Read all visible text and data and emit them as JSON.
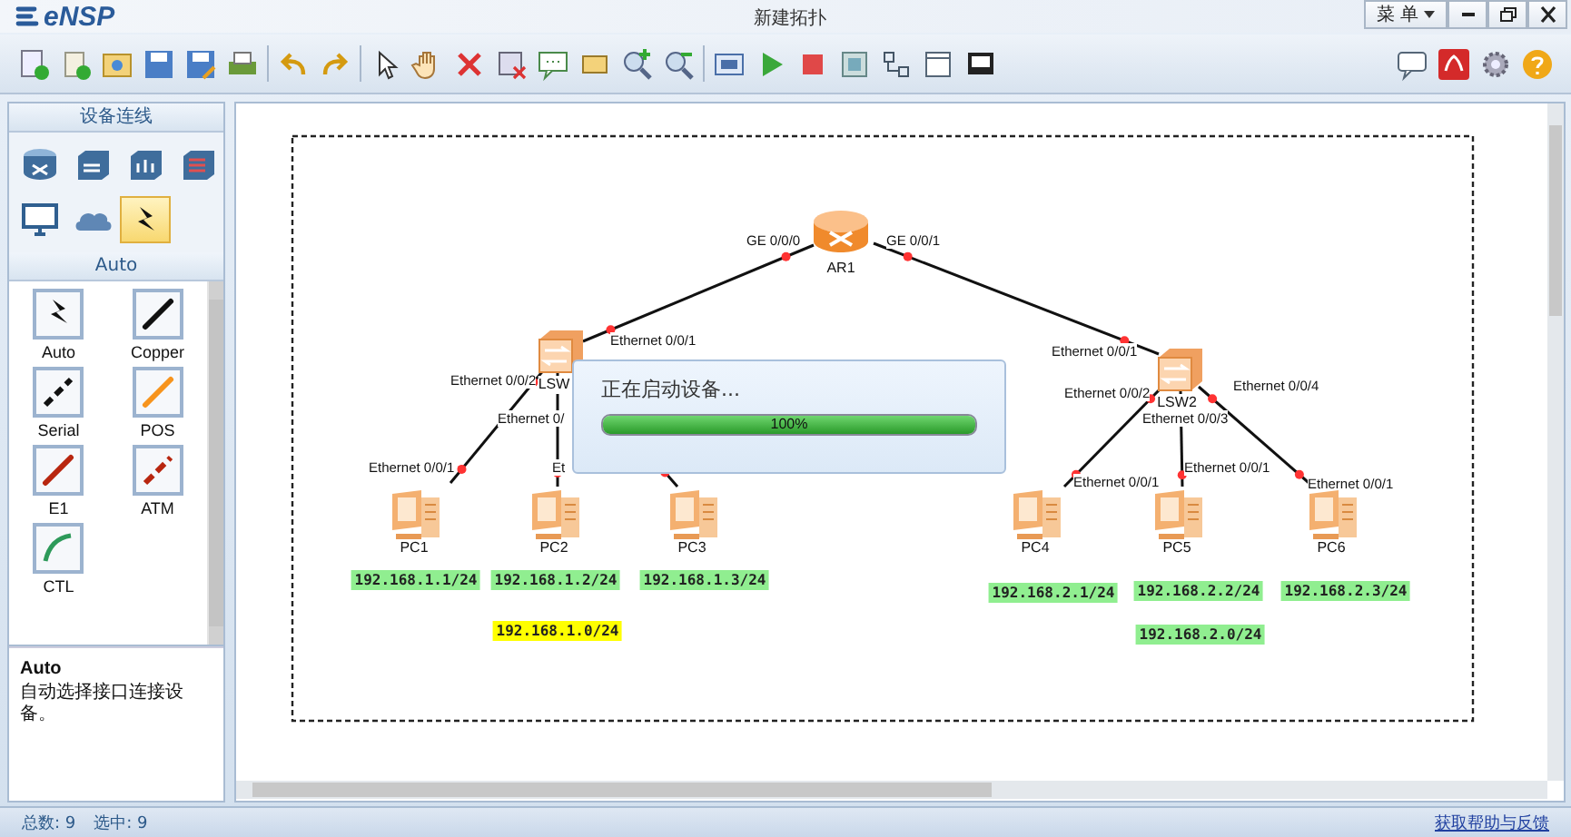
{
  "window": {
    "app_name": "eNSP",
    "title": "新建拓扑",
    "menu_label": "菜 单"
  },
  "sidebar": {
    "title": "设备连线",
    "categories": [
      {
        "kind": "router",
        "selected": false
      },
      {
        "kind": "switch",
        "selected": false
      },
      {
        "kind": "wireless",
        "selected": false
      },
      {
        "kind": "firewall",
        "selected": false
      },
      {
        "kind": "pc",
        "selected": false
      },
      {
        "kind": "cloud",
        "selected": false
      },
      {
        "kind": "cable",
        "selected": true
      }
    ],
    "group_title": "Auto",
    "cable_types": [
      {
        "kind": "auto",
        "label": "Auto"
      },
      {
        "kind": "copper",
        "label": "Copper"
      },
      {
        "kind": "serial",
        "label": "Serial"
      },
      {
        "kind": "pos",
        "label": "POS"
      },
      {
        "kind": "e1",
        "label": "E1"
      },
      {
        "kind": "atm",
        "label": "ATM"
      },
      {
        "kind": "ctl",
        "label": "CTL"
      }
    ],
    "description": {
      "title": "Auto",
      "text": "自动选择接口连接设备。"
    }
  },
  "topology": {
    "nodes": [
      {
        "kind": "router",
        "name": "AR1"
      },
      {
        "kind": "switch",
        "name": "LSW"
      },
      {
        "kind": "switch",
        "name": "LSW2"
      },
      {
        "kind": "pc",
        "name": "PC1"
      },
      {
        "kind": "pc",
        "name": "PC2"
      },
      {
        "kind": "pc",
        "name": "PC3"
      },
      {
        "kind": "pc",
        "name": "PC4"
      },
      {
        "kind": "pc",
        "name": "PC5"
      },
      {
        "kind": "pc",
        "name": "PC6"
      }
    ],
    "links": [
      {
        "kind": "copper",
        "ports": [
          "GE 0/0/0",
          "Ethernet 0/0/1"
        ]
      },
      {
        "kind": "copper",
        "ports": [
          "GE 0/0/1",
          "Ethernet 0/0/1"
        ]
      },
      {
        "kind": "copper",
        "ports": [
          "Ethernet 0/0/2",
          "Ethernet 0/0/1"
        ]
      },
      {
        "kind": "copper",
        "ports": [
          "Ethernet 0/",
          "Et"
        ]
      },
      {
        "kind": "copper"
      },
      {
        "kind": "copper",
        "ports": [
          "Ethernet 0/0/2",
          "Ethernet 0/0/1"
        ]
      },
      {
        "kind": "copper",
        "ports": [
          "Ethernet 0/0/3",
          "Ethernet 0/0/1"
        ]
      },
      {
        "kind": "copper",
        "ports": [
          "Ethernet 0/0/4",
          "Ethernet 0/0/1"
        ]
      }
    ],
    "labels": [
      {
        "text": "192.168.1.1/24",
        "color": "#90ee90"
      },
      {
        "text": "192.168.1.2/24",
        "color": "#90ee90"
      },
      {
        "text": "192.168.1.3/24",
        "color": "#90ee90"
      },
      {
        "text": "192.168.1.0/24",
        "color": "#ffff00"
      },
      {
        "text": "192.168.2.1/24",
        "color": "#90ee90"
      },
      {
        "text": "192.168.2.2/24",
        "color": "#90ee90"
      },
      {
        "text": "192.168.2.3/24",
        "color": "#90ee90"
      },
      {
        "text": "192.168.2.0/24",
        "color": "#90ee90"
      }
    ]
  },
  "progress_dialog": {
    "message": "正在启动设备...",
    "level": 1.0,
    "reading": "100%"
  },
  "status_bar": {
    "total": "总数: 9",
    "selected": "选中: 9",
    "help_link": "获取帮助与反馈"
  }
}
